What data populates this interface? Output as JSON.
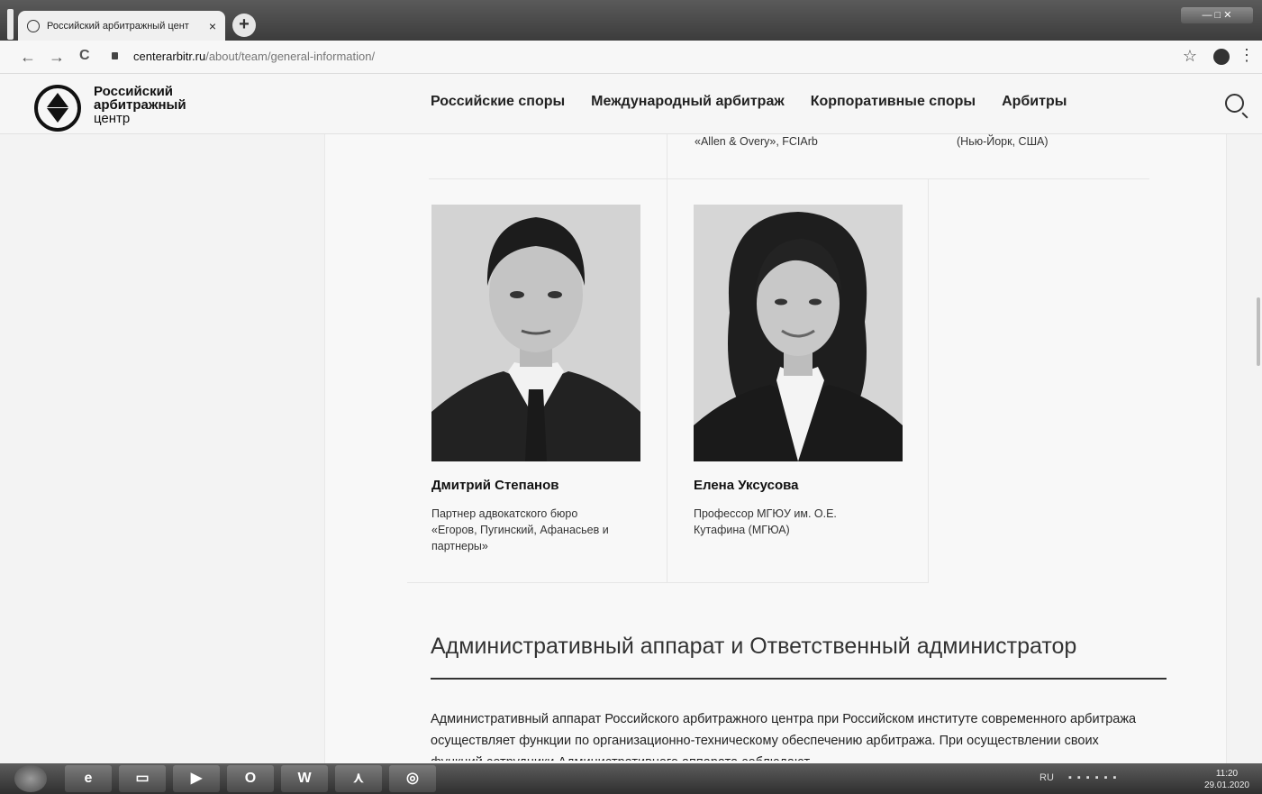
{
  "browser": {
    "tab_title": "Российский арбитражный цент",
    "tab_close": "×",
    "new_tab": "+",
    "window_controls": "— □ ✕",
    "url_host": "centerarbitr.ru",
    "url_path": "/about/team/general-information/",
    "nav_back": "←",
    "nav_forward": "→",
    "nav_reload": "C",
    "bookmark": "☆",
    "menu": "⋮"
  },
  "site": {
    "logo_line1": "Российский",
    "logo_line2": "арбитражный",
    "logo_line3": "центр",
    "nav": [
      "Российские споры",
      "Международный арбитраж",
      "Корпоративные споры",
      "Арбитры"
    ]
  },
  "previous_row": {
    "left": "«Allen & Overy», FCIArb",
    "right": "(Нью-Йорк, США)"
  },
  "people": [
    {
      "name": "Дмитрий Степанов",
      "desc_lines": [
        "Партнер адвокатского бюро",
        "«Егоров, Пугинский, Афанасьев и",
        "партнеры»"
      ]
    },
    {
      "name": "Елена Уксусова",
      "desc_lines": [
        "Профессор МГЮУ им. О.Е.",
        "Кутафина (МГЮА)"
      ]
    }
  ],
  "section": {
    "title": "Административный аппарат и Ответственный администратор",
    "text": "Административный аппарат Российского арбитражного центра при Российском институте современного арбитража осуществляет функции по организационно-техническому обеспечению арбитража. При осуществлении своих функций сотрудники Административного аппарата соблюдают"
  },
  "taskbar": {
    "lang": "RU",
    "time": "11:20",
    "date": "29.01.2020"
  }
}
